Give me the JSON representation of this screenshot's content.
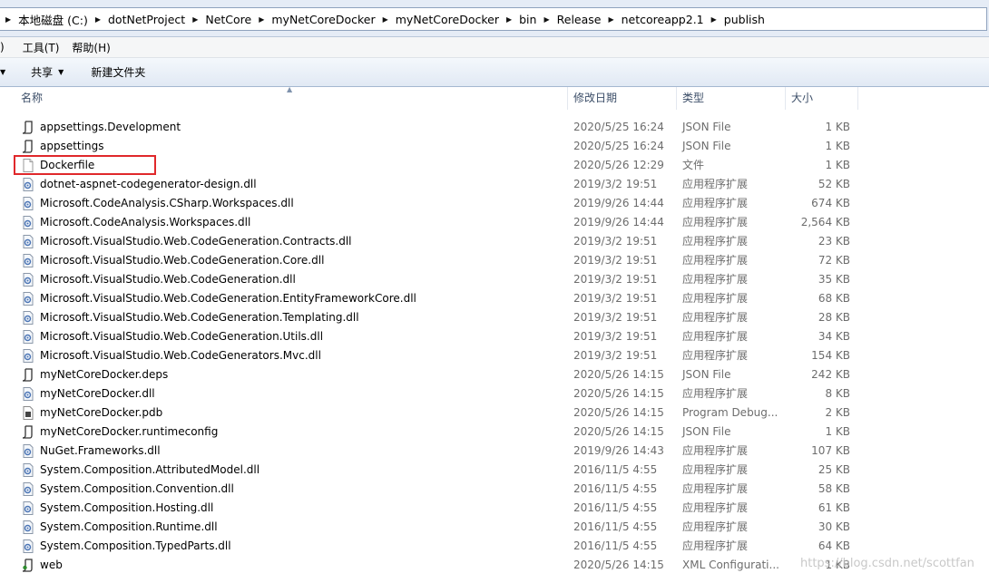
{
  "breadcrumb": [
    "本地磁盘 (C:)",
    "dotNetProject",
    "NetCore",
    "myNetCoreDocker",
    "myNetCoreDocker",
    "bin",
    "Release",
    "netcoreapp2.1",
    "publish"
  ],
  "menu": {
    "partial": ")",
    "tools": "工具(T)",
    "help": "帮助(H)"
  },
  "toolbar": {
    "share": "共享",
    "new_folder": "新建文件夹"
  },
  "columns": {
    "name": "名称",
    "date": "修改日期",
    "type": "类型",
    "size": "大小"
  },
  "highlighted_file": "Dockerfile",
  "files": [
    {
      "name": "appsettings.Development",
      "date": "2020/5/25 16:24",
      "type": "JSON File",
      "size": "1 KB",
      "icon": "json-file-icon"
    },
    {
      "name": "appsettings",
      "date": "2020/5/25 16:24",
      "type": "JSON File",
      "size": "1 KB",
      "icon": "json-file-icon"
    },
    {
      "name": "Dockerfile",
      "date": "2020/5/26 12:29",
      "type": "文件",
      "size": "1 KB",
      "icon": "blank-file-icon"
    },
    {
      "name": "dotnet-aspnet-codegenerator-design.dll",
      "date": "2019/3/2 19:51",
      "type": "应用程序扩展",
      "size": "52 KB",
      "icon": "dll-file-icon"
    },
    {
      "name": "Microsoft.CodeAnalysis.CSharp.Workspaces.dll",
      "date": "2019/9/26 14:44",
      "type": "应用程序扩展",
      "size": "674 KB",
      "icon": "dll-file-icon"
    },
    {
      "name": "Microsoft.CodeAnalysis.Workspaces.dll",
      "date": "2019/9/26 14:44",
      "type": "应用程序扩展",
      "size": "2,564 KB",
      "icon": "dll-file-icon"
    },
    {
      "name": "Microsoft.VisualStudio.Web.CodeGeneration.Contracts.dll",
      "date": "2019/3/2 19:51",
      "type": "应用程序扩展",
      "size": "23 KB",
      "icon": "dll-file-icon"
    },
    {
      "name": "Microsoft.VisualStudio.Web.CodeGeneration.Core.dll",
      "date": "2019/3/2 19:51",
      "type": "应用程序扩展",
      "size": "72 KB",
      "icon": "dll-file-icon"
    },
    {
      "name": "Microsoft.VisualStudio.Web.CodeGeneration.dll",
      "date": "2019/3/2 19:51",
      "type": "应用程序扩展",
      "size": "35 KB",
      "icon": "dll-file-icon"
    },
    {
      "name": "Microsoft.VisualStudio.Web.CodeGeneration.EntityFrameworkCore.dll",
      "date": "2019/3/2 19:51",
      "type": "应用程序扩展",
      "size": "68 KB",
      "icon": "dll-file-icon"
    },
    {
      "name": "Microsoft.VisualStudio.Web.CodeGeneration.Templating.dll",
      "date": "2019/3/2 19:51",
      "type": "应用程序扩展",
      "size": "28 KB",
      "icon": "dll-file-icon"
    },
    {
      "name": "Microsoft.VisualStudio.Web.CodeGeneration.Utils.dll",
      "date": "2019/3/2 19:51",
      "type": "应用程序扩展",
      "size": "34 KB",
      "icon": "dll-file-icon"
    },
    {
      "name": "Microsoft.VisualStudio.Web.CodeGenerators.Mvc.dll",
      "date": "2019/3/2 19:51",
      "type": "应用程序扩展",
      "size": "154 KB",
      "icon": "dll-file-icon"
    },
    {
      "name": "myNetCoreDocker.deps",
      "date": "2020/5/26 14:15",
      "type": "JSON File",
      "size": "242 KB",
      "icon": "json-file-icon"
    },
    {
      "name": "myNetCoreDocker.dll",
      "date": "2020/5/26 14:15",
      "type": "应用程序扩展",
      "size": "8 KB",
      "icon": "dll-file-icon"
    },
    {
      "name": "myNetCoreDocker.pdb",
      "date": "2020/5/26 14:15",
      "type": "Program Debug...",
      "size": "2 KB",
      "icon": "pdb-file-icon"
    },
    {
      "name": "myNetCoreDocker.runtimeconfig",
      "date": "2020/5/26 14:15",
      "type": "JSON File",
      "size": "1 KB",
      "icon": "json-file-icon"
    },
    {
      "name": "NuGet.Frameworks.dll",
      "date": "2019/9/26 14:43",
      "type": "应用程序扩展",
      "size": "107 KB",
      "icon": "dll-file-icon"
    },
    {
      "name": "System.Composition.AttributedModel.dll",
      "date": "2016/11/5 4:55",
      "type": "应用程序扩展",
      "size": "25 KB",
      "icon": "dll-file-icon"
    },
    {
      "name": "System.Composition.Convention.dll",
      "date": "2016/11/5 4:55",
      "type": "应用程序扩展",
      "size": "58 KB",
      "icon": "dll-file-icon"
    },
    {
      "name": "System.Composition.Hosting.dll",
      "date": "2016/11/5 4:55",
      "type": "应用程序扩展",
      "size": "61 KB",
      "icon": "dll-file-icon"
    },
    {
      "name": "System.Composition.Runtime.dll",
      "date": "2016/11/5 4:55",
      "type": "应用程序扩展",
      "size": "30 KB",
      "icon": "dll-file-icon"
    },
    {
      "name": "System.Composition.TypedParts.dll",
      "date": "2016/11/5 4:55",
      "type": "应用程序扩展",
      "size": "64 KB",
      "icon": "dll-file-icon"
    },
    {
      "name": "web",
      "date": "2020/5/26 14:15",
      "type": "XML Configurati...",
      "size": "1 KB",
      "icon": "xml-file-icon"
    }
  ],
  "watermark": "https://blog.csdn.net/scottfan"
}
